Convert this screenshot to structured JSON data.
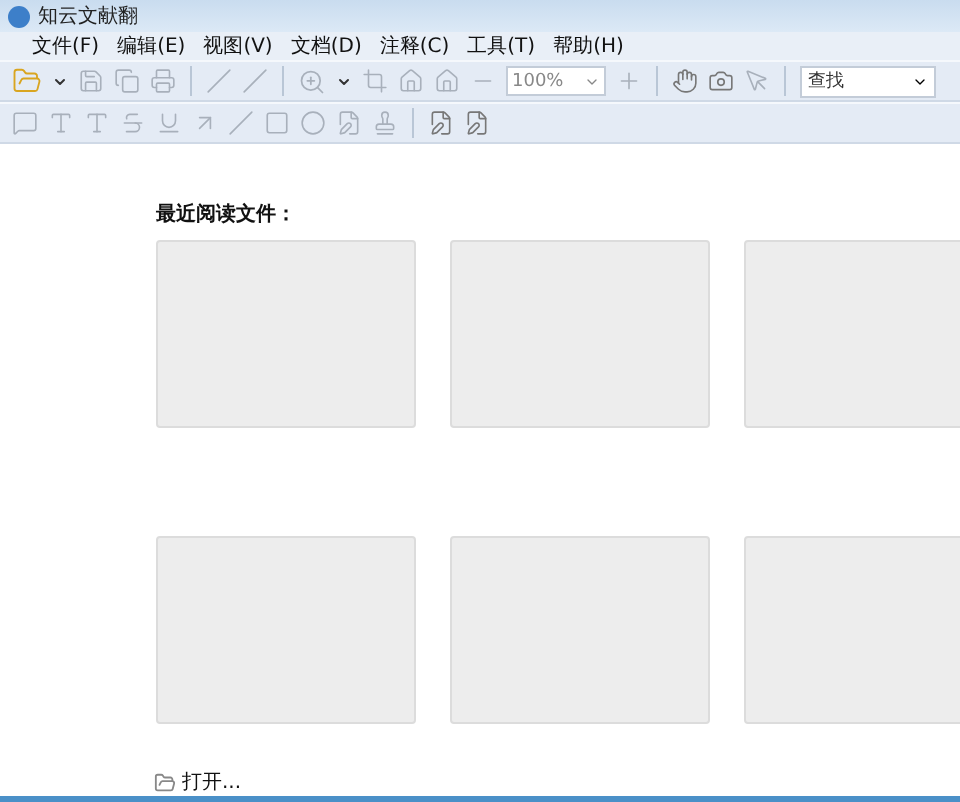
{
  "window": {
    "title": "知云文献翻"
  },
  "menu": [
    "文件(F)",
    "编辑(E)",
    "视图(V)",
    "文档(D)",
    "注释(C)",
    "工具(T)",
    "帮助(H)"
  ],
  "toolbar": {
    "zoom": {
      "value": "100%"
    },
    "search": {
      "value": "查找"
    }
  },
  "recent": {
    "heading": "最近阅读文件：",
    "files": [
      {
        "kind": "empty"
      },
      {
        "kind": "empty"
      },
      {
        "kind": "empty"
      },
      {
        "kind": "empty"
      },
      {
        "kind": "empty"
      },
      {
        "kind": "empty"
      }
    ]
  },
  "open_link": "打开..."
}
